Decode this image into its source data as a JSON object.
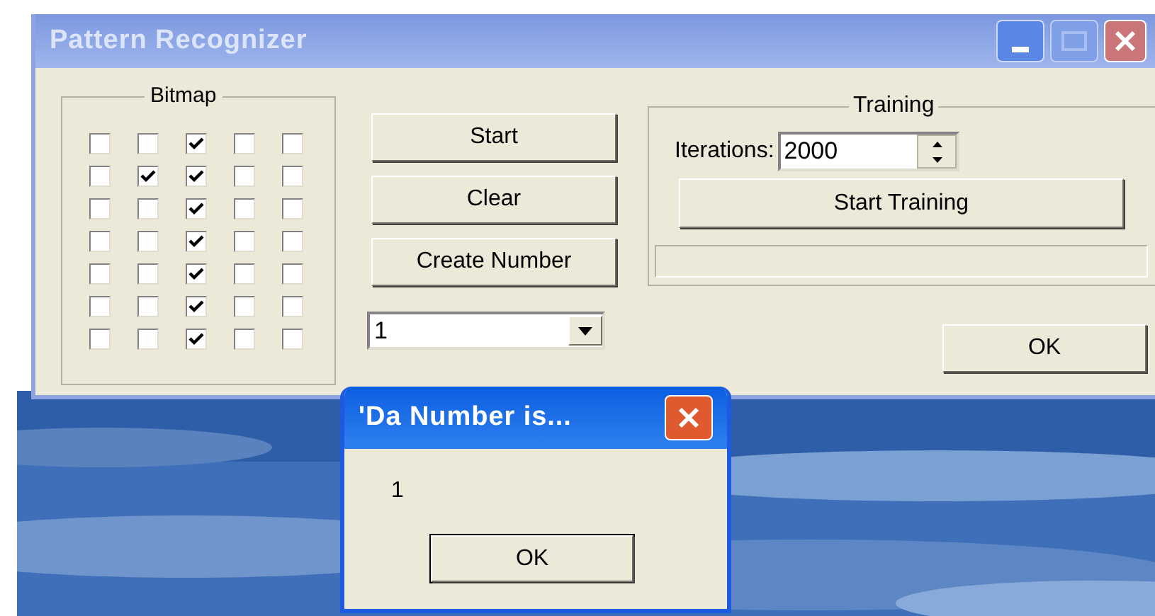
{
  "window": {
    "title": "Pattern Recognizer",
    "active": false
  },
  "bitmap": {
    "title": "Bitmap",
    "rows": [
      [
        {
          "checked": false
        },
        {
          "checked": false
        },
        {
          "checked": true
        },
        {
          "checked": false
        },
        {
          "checked": false
        }
      ],
      [
        {
          "checked": false
        },
        {
          "checked": true
        },
        {
          "checked": true
        },
        {
          "checked": false
        },
        {
          "checked": false
        }
      ],
      [
        {
          "checked": false
        },
        {
          "checked": false
        },
        {
          "checked": true
        },
        {
          "checked": false
        },
        {
          "checked": false
        }
      ],
      [
        {
          "checked": false
        },
        {
          "checked": false
        },
        {
          "checked": true
        },
        {
          "checked": false
        },
        {
          "checked": false
        }
      ],
      [
        {
          "checked": false
        },
        {
          "checked": false
        },
        {
          "checked": true
        },
        {
          "checked": false
        },
        {
          "checked": false
        }
      ],
      [
        {
          "checked": false
        },
        {
          "checked": false
        },
        {
          "checked": true
        },
        {
          "checked": false
        },
        {
          "checked": false
        }
      ],
      [
        {
          "checked": false
        },
        {
          "checked": false
        },
        {
          "checked": true
        },
        {
          "checked": false
        },
        {
          "checked": false
        }
      ]
    ]
  },
  "buttons": [
    "Start",
    "Clear",
    "Create Number"
  ],
  "number_dropdown": {
    "value": "1"
  },
  "training": {
    "title": "Training",
    "iterations_label": "Iterations:",
    "iterations_value": "2000",
    "button": "Start Training",
    "progress": {
      "level": 0
    }
  },
  "ok_button": "OK",
  "dialog": {
    "title": "'Da Number is...",
    "active": true,
    "message": "1",
    "ok_button": "OK"
  }
}
